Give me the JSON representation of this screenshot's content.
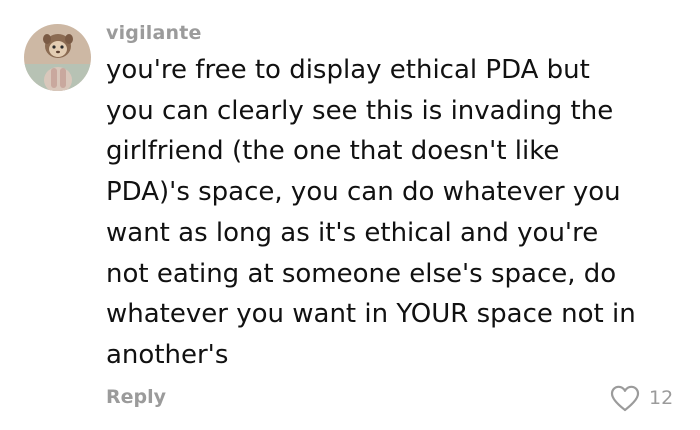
{
  "comment": {
    "username": "vigilante",
    "avatar_icon": "user-avatar",
    "text_lines": [
      "you're free to display ethical PDA but",
      "you can clearly see this is invading the",
      "girlfriend (the one that doesn't like",
      "PDA)'s space, you can do whatever you",
      "want as long as it's ethical and you're",
      "not eating at someone else's space, do",
      "whatever you want in YOUR space not in",
      "another's"
    ],
    "reply_label": "Reply",
    "like_icon": "heart-outline-icon",
    "like_count": "12"
  },
  "colors": {
    "text": "#111111",
    "muted": "#9b9b9b",
    "background": "#ffffff"
  }
}
